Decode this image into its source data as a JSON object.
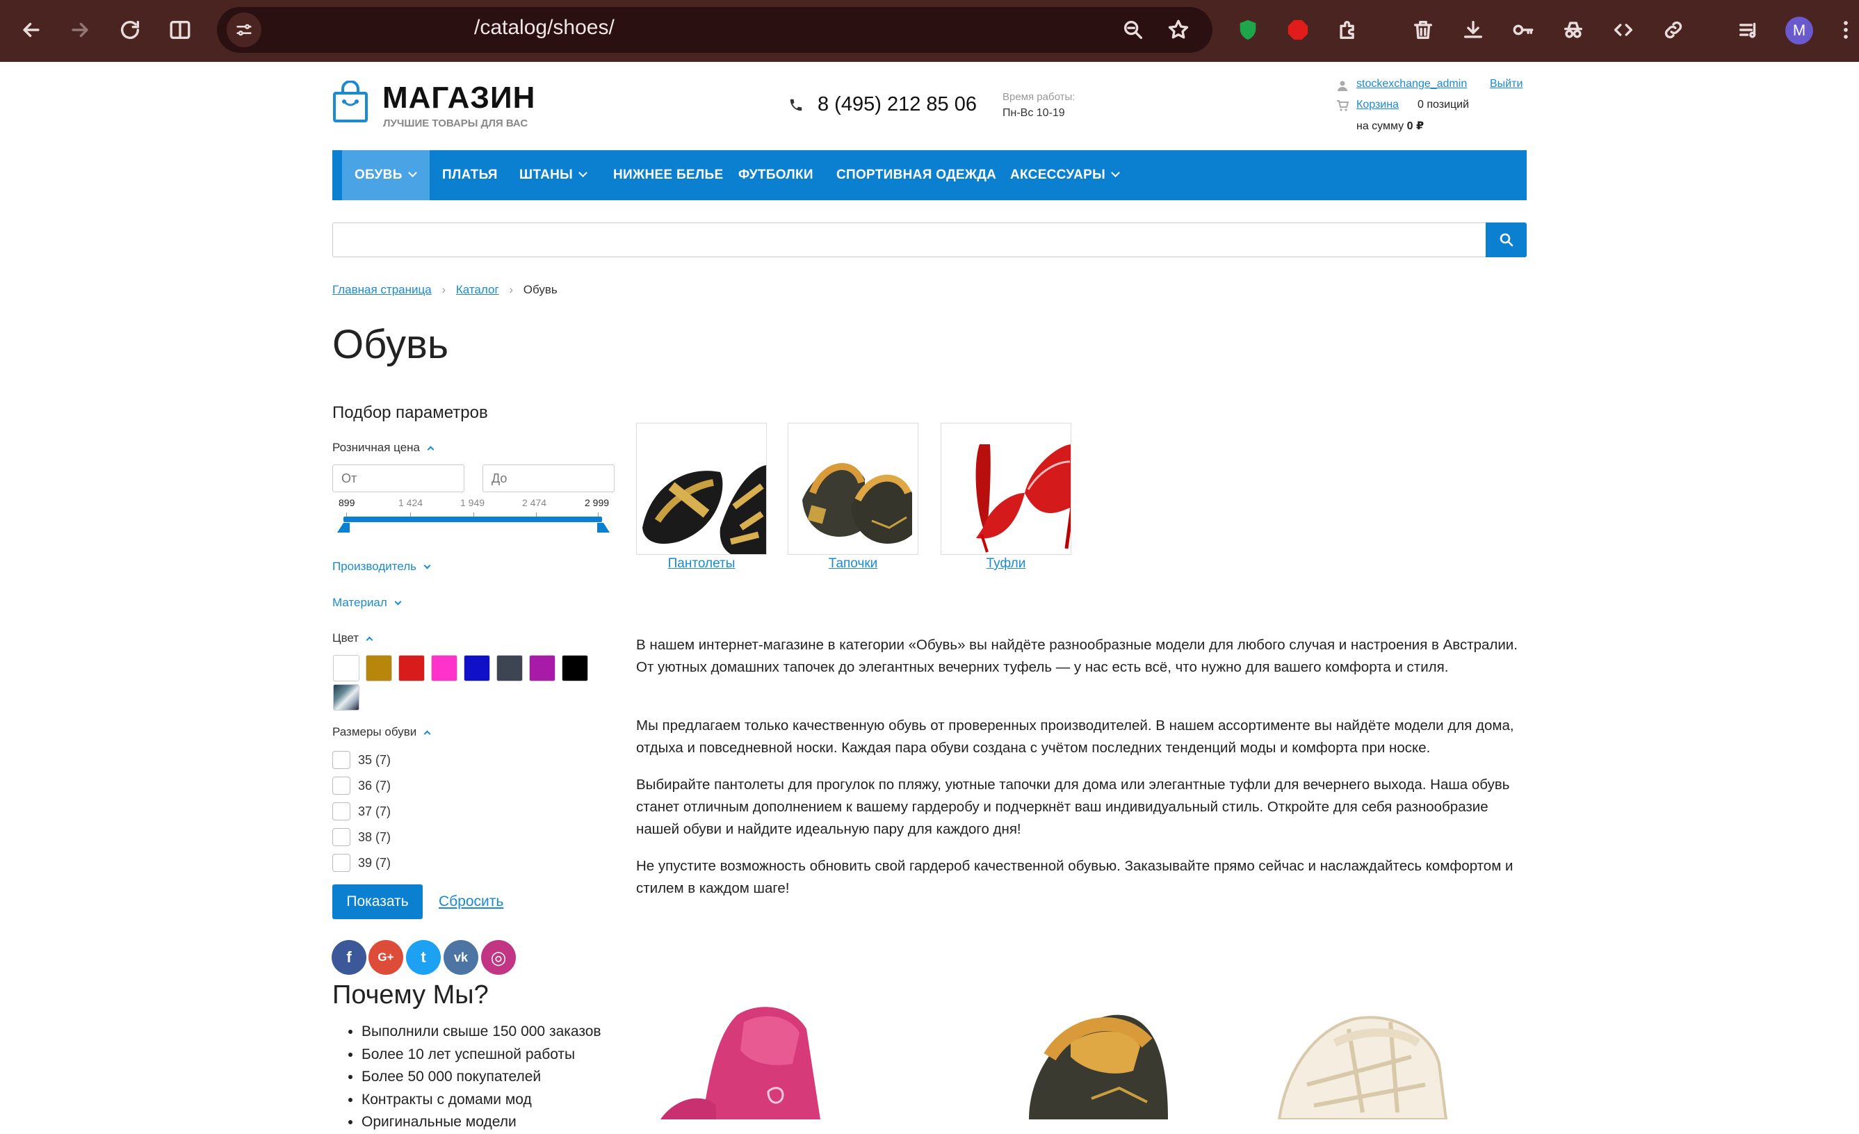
{
  "browser": {
    "url": "/catalog/shoes/",
    "avatar_letter": "M"
  },
  "header": {
    "logo_title": "МАГАЗИН",
    "logo_subtitle": "ЛУЧШИЕ ТОВАРЫ ДЛЯ ВАС",
    "phone": "8 (495) 212 85 06",
    "hours_label": "Время работы:",
    "hours_value": "Пн-Вс 10-19",
    "user_name": "stockexchange_admin",
    "logout": "Выйти",
    "cart_link": "Корзина",
    "cart_count": "0 позиций",
    "cart_sum_label": "на сумму",
    "cart_sum_value": "0 ₽"
  },
  "nav": {
    "items": [
      {
        "label": "ОБУВЬ",
        "dropdown": true,
        "active": true
      },
      {
        "label": "ПЛАТЬЯ",
        "dropdown": false
      },
      {
        "label": "ШТАНЫ",
        "dropdown": true
      },
      {
        "label": "НИЖНЕЕ БЕЛЬЕ",
        "dropdown": false
      },
      {
        "label": "ФУТБОЛКИ",
        "dropdown": false
      },
      {
        "label": "СПОРТИВНАЯ ОДЕЖДА",
        "dropdown": false
      },
      {
        "label": "АКСЕССУАРЫ",
        "dropdown": true
      }
    ]
  },
  "search": {
    "placeholder": "",
    "value": ""
  },
  "breadcrumb": {
    "home": "Главная страница",
    "catalog": "Каталог",
    "current": "Обувь"
  },
  "page_title": "Обувь",
  "filter": {
    "title": "Подбор параметров",
    "price_label": "Розничная цена",
    "price_from_placeholder": "От",
    "price_to_placeholder": "До",
    "price_ticks": [
      "899",
      "1 424",
      "1 949",
      "2 474",
      "2 999"
    ],
    "manufacturer_label": "Производитель",
    "material_label": "Материал",
    "color_label": "Цвет",
    "colors": [
      "#ffffff",
      "#b8860b",
      "#d81b1b",
      "#ff33cc",
      "#1010c8",
      "#3d4552",
      "#a81aa8",
      "#000000"
    ],
    "sizes_label": "Размеры обуви",
    "sizes": [
      "35 (7)",
      "36 (7)",
      "37 (7)",
      "38 (7)",
      "39 (7)"
    ],
    "show_button": "Показать",
    "reset_link": "Сбросить"
  },
  "subcategories": [
    {
      "label": "Пантолеты"
    },
    {
      "label": "Тапочки"
    },
    {
      "label": "Туфли"
    }
  ],
  "description": [
    "В нашем интернет-магазине в категории «Обувь» вы найдёте разнообразные модели для любого случая и настроения в Австралии. От уютных домашних тапочек до элегантных вечерних туфель — у нас есть всё, что нужно для вашего комфорта и стиля.",
    "Мы предлагаем только качественную обувь от проверенных производителей. В нашем ассортименте вы найдёте модели для дома, отдыха и повседневной носки. Каждая пара обуви создана с учётом последних тенденций моды и комфорта при носке.",
    "Выбирайте пантолеты для прогулок по пляжу, уютные тапочки для дома или элегантные туфли для вечернего выхода. Наша обувь станет отличным дополнением к вашему гардеробу и подчеркнёт ваш индивидуальный стиль. Откройте для себя разнообразие нашей обуви и найдите идеальную пару для каждого дня!",
    "Не упустите возможность обновить свой гардероб качественной обувью. Заказывайте прямо сейчас и наслаждайтесь комфортом и стилем в каждом шаге!"
  ],
  "social": [
    {
      "icon": "facebook-icon",
      "glyph": "f",
      "color": "#3b5998"
    },
    {
      "icon": "google-plus-icon",
      "glyph": "G+",
      "color": "#dd4b39"
    },
    {
      "icon": "twitter-icon",
      "glyph": "t",
      "color": "#1da1f2"
    },
    {
      "icon": "vk-icon",
      "glyph": "vk",
      "color": "#4c75a3"
    },
    {
      "icon": "instagram-icon",
      "glyph": "◎",
      "color": "#c13584"
    }
  ],
  "why_us": {
    "title": "Почему Мы?",
    "items": [
      "Выполнили свыше 150 000 заказов",
      "Более 10 лет успешной работы",
      "Более 50 000 покупателей",
      "Контракты с домами мод",
      "Оригинальные модели"
    ]
  }
}
